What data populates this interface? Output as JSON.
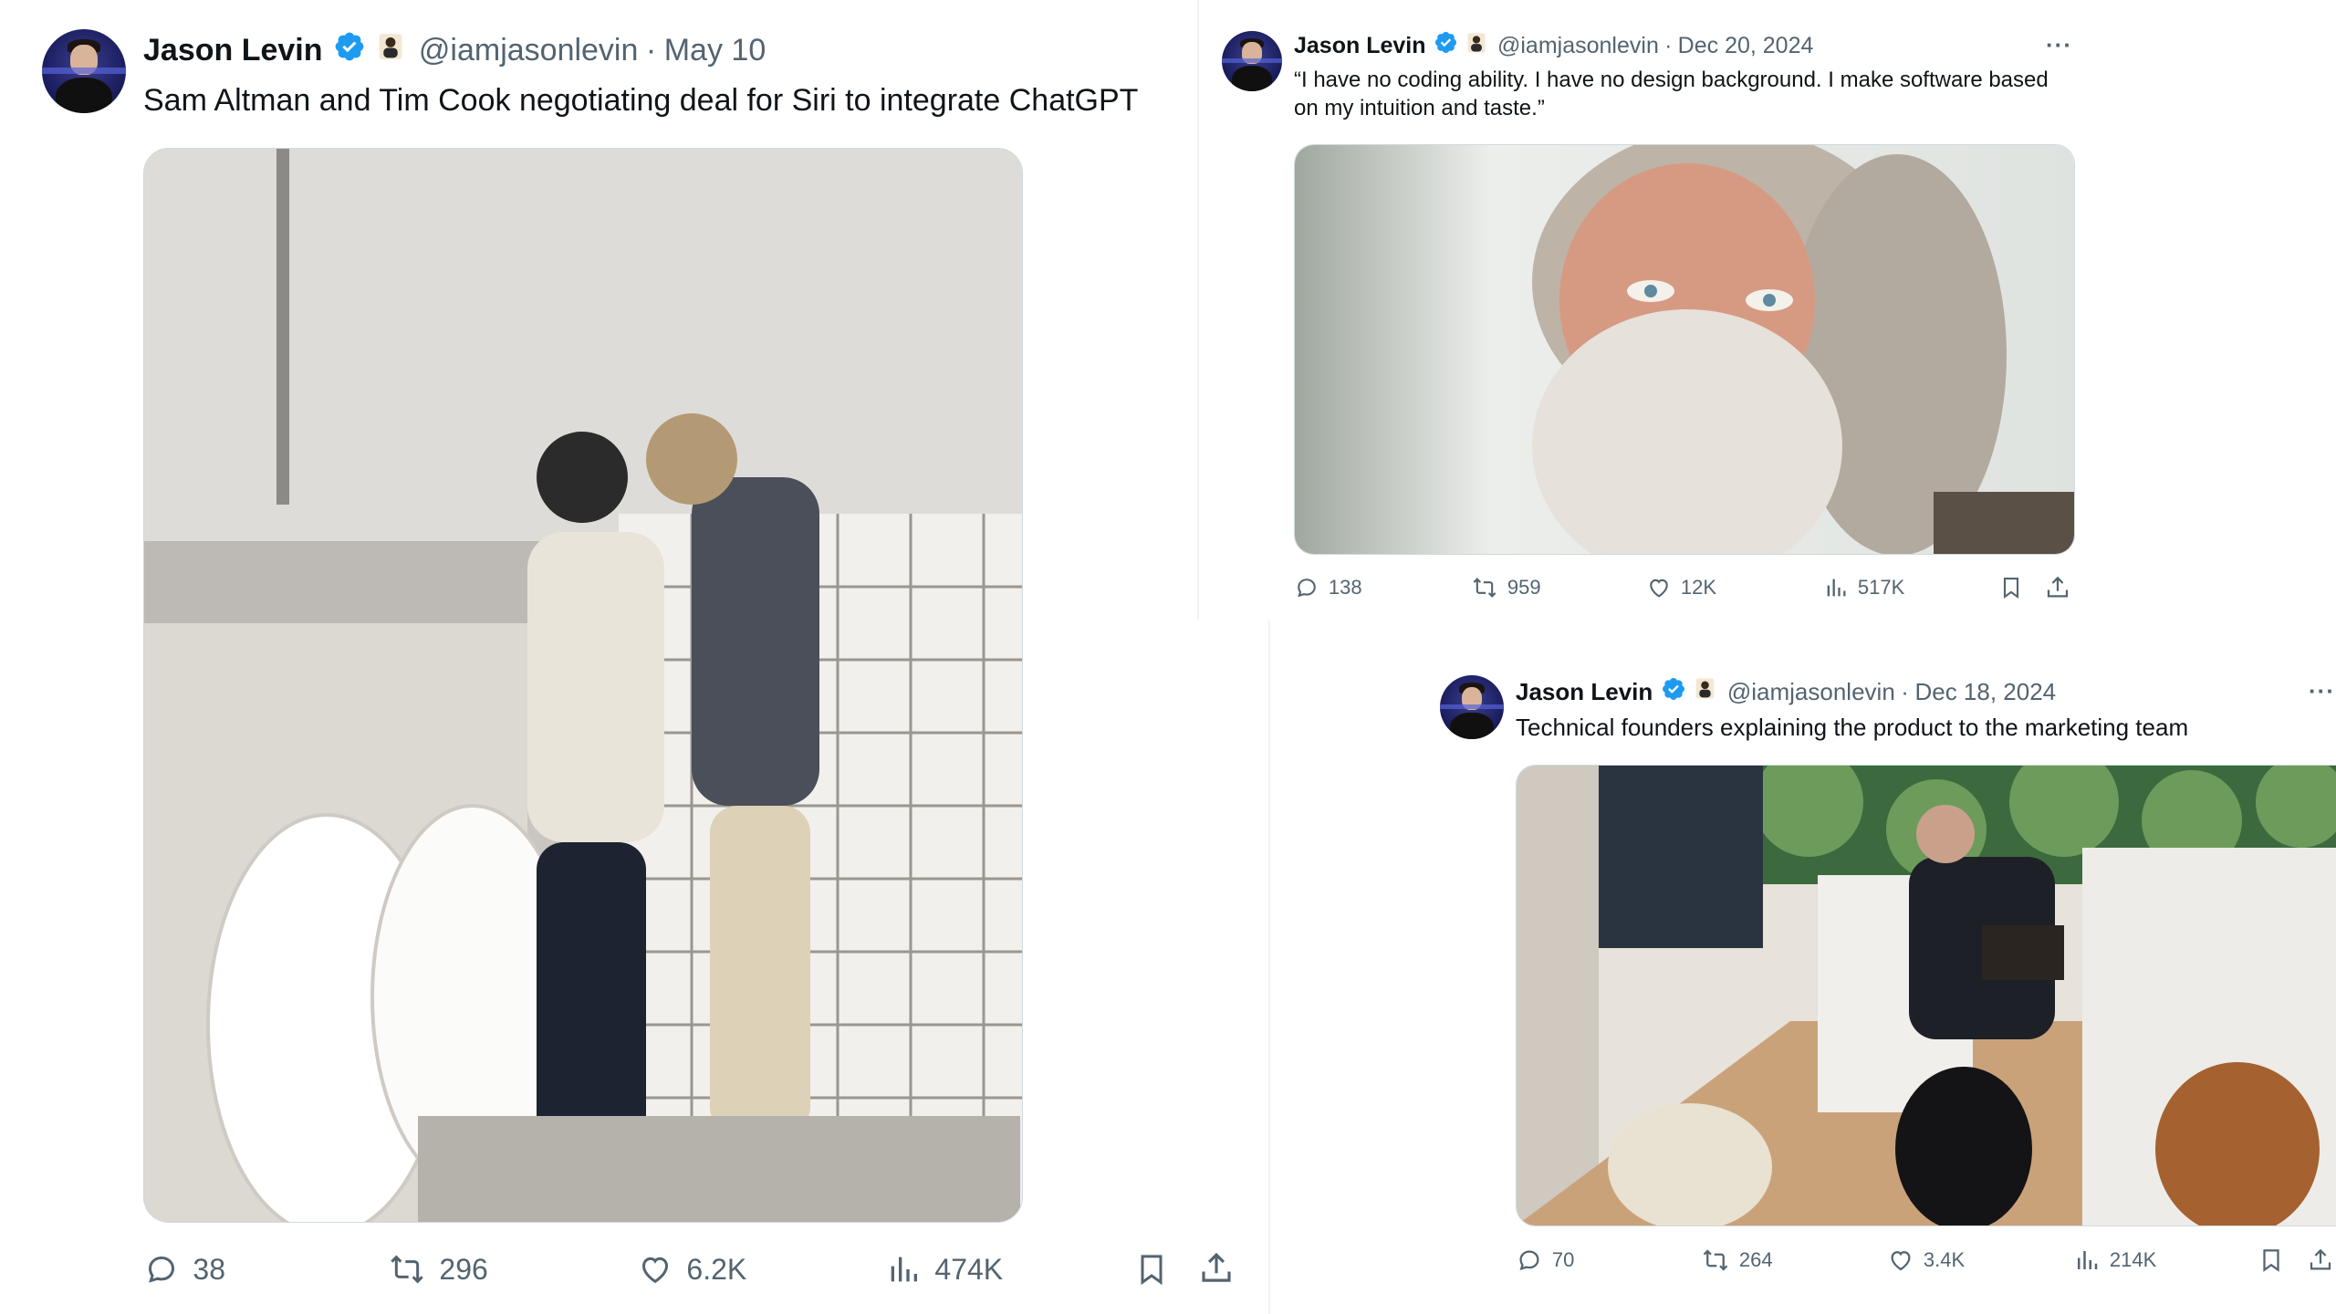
{
  "colors": {
    "text": "#0f1419",
    "muted": "#536471",
    "verified": "#1d9bf0",
    "border": "#cfd9de"
  },
  "tweets": [
    {
      "name": "Jason Levin",
      "handle": "@iamjasonlevin",
      "separator": "·",
      "date": "May 10",
      "text": "Sam Altman and Tim Cook negotiating deal for Siri to integrate ChatGPT",
      "media_icon": "photo",
      "stats": {
        "replies": "38",
        "reposts": "296",
        "likes": "6.2K",
        "views": "474K"
      }
    },
    {
      "name": "Jason Levin",
      "handle": "@iamjasonlevin",
      "separator": "·",
      "date": "Dec 20, 2024",
      "text": "“I have no coding ability. I have no design background. I make software based on my intuition and taste.”",
      "more": "···",
      "media_icon": "photo",
      "stats": {
        "replies": "138",
        "reposts": "959",
        "likes": "12K",
        "views": "517K"
      }
    },
    {
      "name": "Jason Levin",
      "handle": "@iamjasonlevin",
      "separator": "·",
      "date": "Dec 18, 2024",
      "text": "Technical founders explaining the product to the marketing team",
      "more": "···",
      "media_icon": "photo",
      "stats": {
        "replies": "70",
        "reposts": "264",
        "likes": "3.4K",
        "views": "214K"
      }
    }
  ]
}
